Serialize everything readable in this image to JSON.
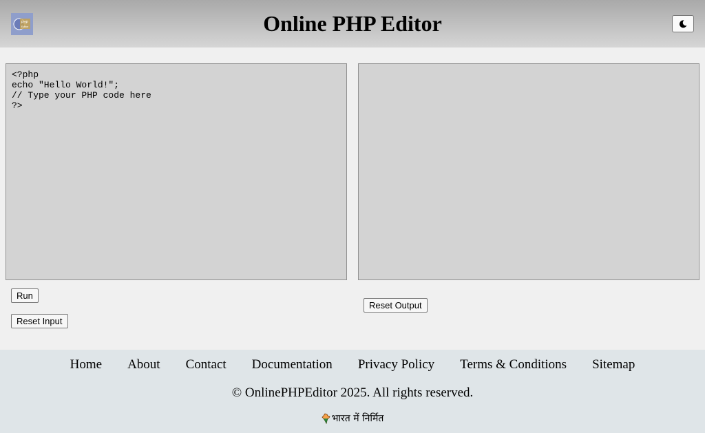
{
  "header": {
    "title": "Online PHP Editor",
    "logo_alt": "PHP Editor",
    "theme_icon": "moon-icon"
  },
  "editor": {
    "code": "<?php\necho \"Hello World!\";\n// Type your PHP code here\n?>"
  },
  "output": {
    "value": ""
  },
  "buttons": {
    "run": "Run",
    "reset_input": "Reset Input",
    "reset_output": "Reset Output"
  },
  "footer": {
    "links": [
      "Home",
      "About",
      "Contact",
      "Documentation",
      "Privacy Policy",
      "Terms & Conditions",
      "Sitemap"
    ],
    "copyright": "© OnlinePHPEditor 2025. All rights reserved.",
    "tagline_icon": "india-map-icon",
    "tagline": "भारत में निर्मित"
  },
  "colors": {
    "header_gradient_top": "#a9a9a9",
    "header_gradient_bottom": "#d6d6d6",
    "page_bg": "#f0f0f0",
    "panel_bg": "#d3d3d3",
    "footer_bg": "#dfe5e8"
  }
}
